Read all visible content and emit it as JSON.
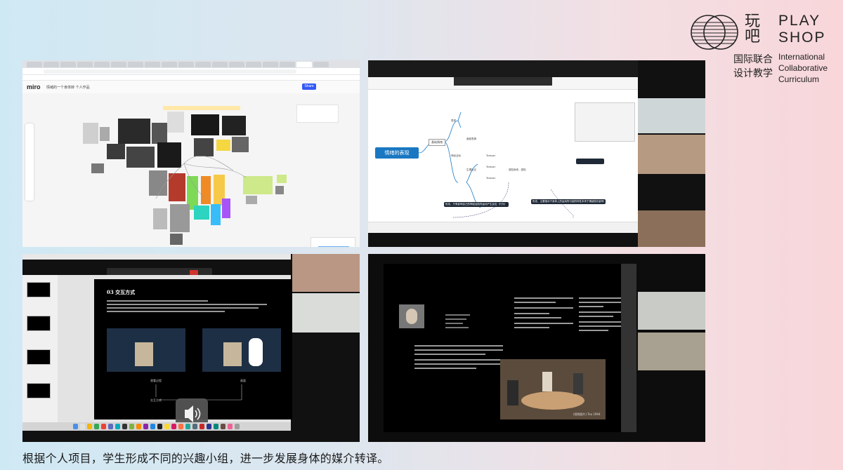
{
  "logo": {
    "cn_top": "玩吧",
    "cn_line1": "国际联合",
    "cn_line2": "设计教学",
    "en_line1": "PLAY",
    "en_line2": "SHOP",
    "en_line3": "International",
    "en_line4": "Collaborative",
    "en_line5": "Curriculum"
  },
  "miro": {
    "logo_text": "miro",
    "board_title": "情绪的一个身体转 个人作品",
    "share_label": "Share"
  },
  "mindmap": {
    "central_topic": "情绪的表现",
    "branch_main": "基础情绪",
    "branch_1": "表现",
    "branch_2": "面部表情",
    "branch_3": "神经活动",
    "branch_4": "生理反应",
    "note_1": "形态，只有影响自己的神经及肌肉运动产生反应（行为）",
    "note_2": "形态，主要指对于身体上的运动所引起的特性本来于情绪变化影响",
    "note_3": "感知身体，感知",
    "tag_1": "Tarasan",
    "tag_2": "Tarasan",
    "tag_3": "Tarasan"
  },
  "presentation": {
    "slide_title": "03 交互方式",
    "label_left": "观看过程",
    "label_right": "画面",
    "label_bottom": "交互方式",
    "audio_icon": "volume-icon"
  },
  "document": {
    "caption_small": "(视频图片) Tea 1994"
  },
  "caption": "根据个人项目，学生形成不同的兴趣小组，进一步发展身体的媒介转译。"
}
